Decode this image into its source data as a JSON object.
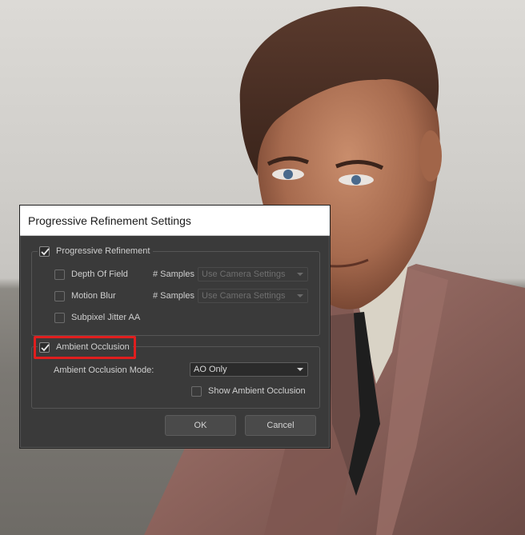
{
  "dialog": {
    "title": "Progressive Refinement Settings",
    "progressive_refinement": {
      "label": "Progressive Refinement",
      "checked": true,
      "depth_of_field": {
        "label": "Depth Of Field",
        "checked": false,
        "samples_label": "# Samples",
        "samples_value": "Use Camera Settings"
      },
      "motion_blur": {
        "label": "Motion Blur",
        "checked": false,
        "samples_label": "# Samples",
        "samples_value": "Use Camera Settings"
      },
      "subpixel_jitter": {
        "label": "Subpixel Jitter AA",
        "checked": false
      }
    },
    "ambient_occlusion": {
      "label": "Ambient Occlusion",
      "checked": true,
      "mode_label": "Ambient Occlusion Mode:",
      "mode_value": "AO Only",
      "show_label": "Show Ambient Occlusion",
      "show_checked": false
    },
    "buttons": {
      "ok": "OK",
      "cancel": "Cancel"
    }
  },
  "annotation": {
    "color": "#e01e1e"
  }
}
